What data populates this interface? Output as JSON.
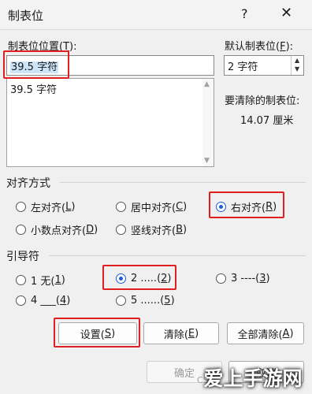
{
  "window": {
    "title": "制表位",
    "help": "?",
    "close": "✕"
  },
  "tab_position": {
    "label_prefix": "制表位位置(",
    "label_key": "T",
    "label_suffix": "):",
    "value": "39.5 字符",
    "list": [
      "39.5 字符"
    ]
  },
  "default_tabs": {
    "label_prefix": "默认制表位(",
    "label_key": "F",
    "label_suffix": "):",
    "value": "2 字符"
  },
  "to_clear": {
    "label": "要清除的制表位:",
    "value": "14.07 厘米"
  },
  "alignment": {
    "title": "对齐方式",
    "options": [
      {
        "pre": "左对齐(",
        "key": "L",
        "post": ")"
      },
      {
        "pre": "居中对齐(",
        "key": "C",
        "post": ")"
      },
      {
        "pre": "右对齐(",
        "key": "R",
        "post": ")"
      },
      {
        "pre": "小数点对齐(",
        "key": "D",
        "post": ")"
      },
      {
        "pre": "竖线对齐(",
        "key": "B",
        "post": ")"
      }
    ],
    "selected": "右对齐(R)"
  },
  "leader": {
    "title": "引导符",
    "options": [
      {
        "pre": "1 无(",
        "key": "1",
        "post": ")"
      },
      {
        "pre": "2 .....(",
        "key": "2",
        "post": ")"
      },
      {
        "pre": "3 ----(",
        "key": "3",
        "post": ")"
      },
      {
        "pre": "4 ___(",
        "key": "4",
        "post": ")"
      },
      {
        "pre": "5 ......(",
        "key": "5",
        "post": ")"
      }
    ],
    "selected": "2 .....(2)"
  },
  "buttons": {
    "set": {
      "pre": "设置(",
      "key": "S",
      "post": ")"
    },
    "clear": {
      "pre": "清除(",
      "key": "E",
      "post": ")"
    },
    "clear_all": {
      "pre": "全部清除(",
      "key": "A",
      "post": ")"
    },
    "ok": "确定",
    "cancel": "取消"
  },
  "watermark": {
    "text": "爱上手游网",
    "small": "CSD"
  },
  "colors": {
    "highlight": "#e02020",
    "radio_selected": "#1d5fd0",
    "selection": "#cce4f7"
  }
}
